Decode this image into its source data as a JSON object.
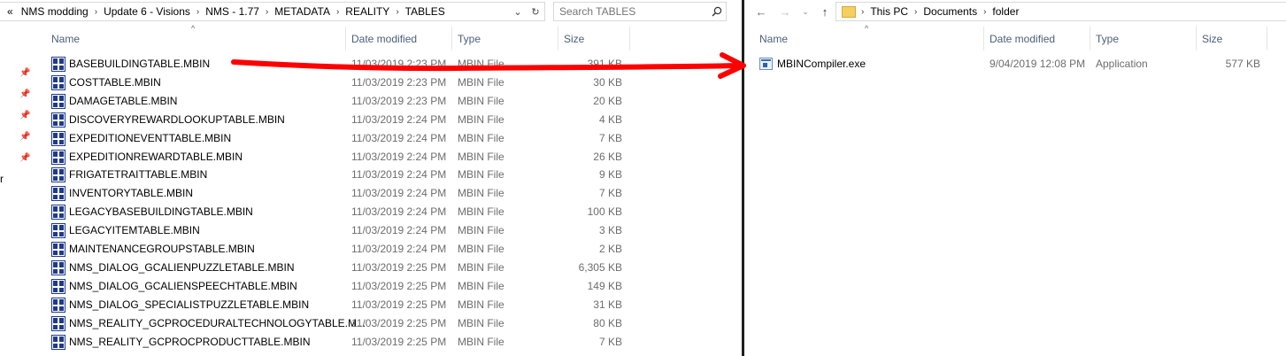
{
  "left": {
    "breadcrumb": {
      "overflow": "«",
      "items": [
        "NMS modding",
        "Update 6 - Visions",
        "NMS - 1.77",
        "METADATA",
        "REALITY",
        "TABLES"
      ]
    },
    "search_placeholder": "Search TABLES",
    "columns": {
      "name": "Name",
      "date": "Date modified",
      "type": "Type",
      "size": "Size"
    },
    "sidebar_fragment": "r",
    "files": [
      {
        "name": "BASEBUILDINGTABLE.MBIN",
        "date": "11/03/2019 2:23 PM",
        "type": "MBIN File",
        "size": "391 KB"
      },
      {
        "name": "COSTTABLE.MBIN",
        "date": "11/03/2019 2:23 PM",
        "type": "MBIN File",
        "size": "30 KB"
      },
      {
        "name": "DAMAGETABLE.MBIN",
        "date": "11/03/2019 2:23 PM",
        "type": "MBIN File",
        "size": "20 KB"
      },
      {
        "name": "DISCOVERYREWARDLOOKUPTABLE.MBIN",
        "date": "11/03/2019 2:24 PM",
        "type": "MBIN File",
        "size": "4 KB"
      },
      {
        "name": "EXPEDITIONEVENTTABLE.MBIN",
        "date": "11/03/2019 2:24 PM",
        "type": "MBIN File",
        "size": "7 KB"
      },
      {
        "name": "EXPEDITIONREWARDTABLE.MBIN",
        "date": "11/03/2019 2:24 PM",
        "type": "MBIN File",
        "size": "26 KB"
      },
      {
        "name": "FRIGATETRAITTABLE.MBIN",
        "date": "11/03/2019 2:24 PM",
        "type": "MBIN File",
        "size": "9 KB"
      },
      {
        "name": "INVENTORYTABLE.MBIN",
        "date": "11/03/2019 2:24 PM",
        "type": "MBIN File",
        "size": "7 KB"
      },
      {
        "name": "LEGACYBASEBUILDINGTABLE.MBIN",
        "date": "11/03/2019 2:24 PM",
        "type": "MBIN File",
        "size": "100 KB"
      },
      {
        "name": "LEGACYITEMTABLE.MBIN",
        "date": "11/03/2019 2:24 PM",
        "type": "MBIN File",
        "size": "3 KB"
      },
      {
        "name": "MAINTENANCEGROUPSTABLE.MBIN",
        "date": "11/03/2019 2:24 PM",
        "type": "MBIN File",
        "size": "2 KB"
      },
      {
        "name": "NMS_DIALOG_GCALIENPUZZLETABLE.MBIN",
        "date": "11/03/2019 2:25 PM",
        "type": "MBIN File",
        "size": "6,305 KB"
      },
      {
        "name": "NMS_DIALOG_GCALIENSPEECHTABLE.MBIN",
        "date": "11/03/2019 2:25 PM",
        "type": "MBIN File",
        "size": "149 KB"
      },
      {
        "name": "NMS_DIALOG_SPECIALISTPUZZLETABLE.MBIN",
        "date": "11/03/2019 2:25 PM",
        "type": "MBIN File",
        "size": "31 KB"
      },
      {
        "name": "NMS_REALITY_GCPROCEDURALTECHNOLOGYTABLE.M...",
        "date": "11/03/2019 2:25 PM",
        "type": "MBIN File",
        "size": "80 KB"
      },
      {
        "name": "NMS_REALITY_GCPROCPRODUCTTABLE.MBIN",
        "date": "11/03/2019 2:25 PM",
        "type": "MBIN File",
        "size": "7 KB"
      }
    ]
  },
  "right": {
    "breadcrumb": {
      "items": [
        "This PC",
        "Documents",
        "folder"
      ]
    },
    "columns": {
      "name": "Name",
      "date": "Date modified",
      "type": "Type",
      "size": "Size"
    },
    "files": [
      {
        "name": "MBINCompiler.exe",
        "date": "9/04/2019 12:08 PM",
        "type": "Application",
        "size": "577 KB"
      }
    ]
  },
  "colors": {
    "arrow": "#ff0000",
    "header_text": "#4c607a",
    "mbin_icon": "#1f3a8a"
  }
}
